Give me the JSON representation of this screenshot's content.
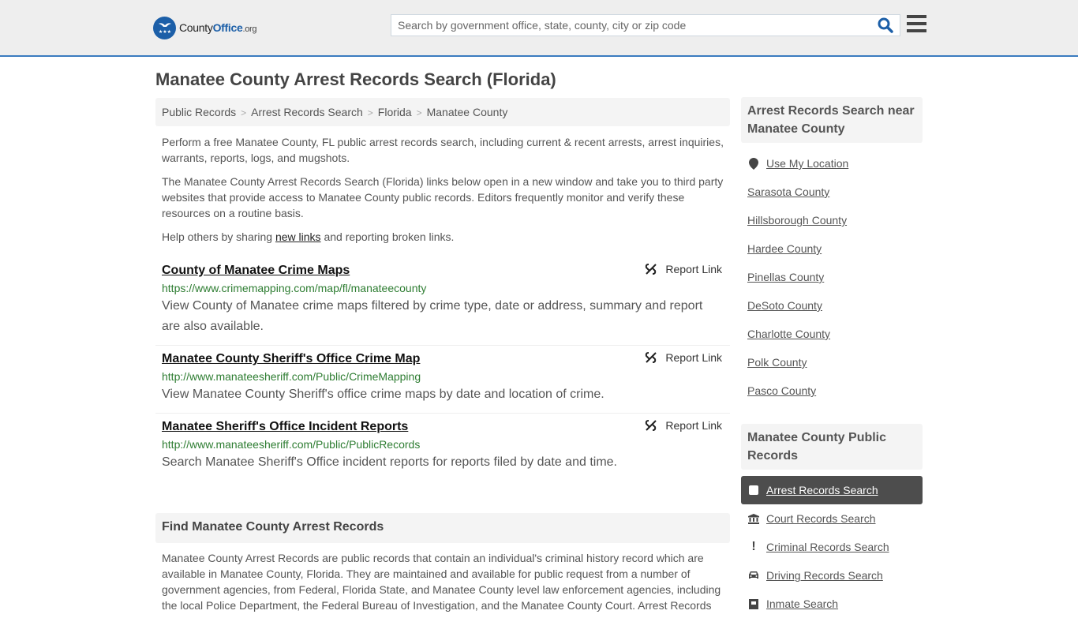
{
  "header": {
    "logo": {
      "brand_plain": "County",
      "brand_bold": "Office",
      "brand_tld": ".org"
    },
    "search": {
      "placeholder": "Search by government office, state, county, city or zip code",
      "value": ""
    },
    "icons": {
      "search": "search-icon",
      "menu": "hamburger-menu-icon"
    }
  },
  "page": {
    "title": "Manatee County Arrest Records Search (Florida)"
  },
  "breadcrumb": [
    "Public Records",
    "Arrest Records Search",
    "Florida",
    "Manatee County"
  ],
  "intro": {
    "p1": "Perform a free Manatee County, FL public arrest records search, including current & recent arrests, arrest inquiries, warrants, reports, logs, and mugshots.",
    "p2": "The Manatee County Arrest Records Search (Florida) links below open in a new window and take you to third party websites that provide access to Manatee County public records. Editors frequently monitor and verify these resources on a routine basis.",
    "p3_before": "Help others by sharing ",
    "p3_link": "new links",
    "p3_after": " and reporting broken links."
  },
  "links": [
    {
      "title": "County of Manatee Crime Maps",
      "url": "https://www.crimemapping.com/map/fl/manateecounty",
      "description": "View County of Manatee crime maps filtered by crime type, date or address, summary and report are also available.",
      "report_label": "Report Link"
    },
    {
      "title": "Manatee County Sheriff's Office Crime Map",
      "url": "http://www.manateesheriff.com/Public/CrimeMapping",
      "description": "View Manatee County Sheriff's office crime maps by date and location of crime.",
      "report_label": "Report Link"
    },
    {
      "title": "Manatee Sheriff's Office Incident Reports",
      "url": "http://www.manateesheriff.com/Public/PublicRecords",
      "description": "Search Manatee Sheriff's Office incident reports for reports filed by date and time.",
      "report_label": "Report Link"
    }
  ],
  "find": {
    "heading": "Find Manatee County Arrest Records",
    "body": "Manatee County Arrest Records are public records that contain an individual's criminal history record which are available in Manatee County, Florida. They are maintained and available for public request from a number of government agencies, from Federal, Florida State, and Manatee County level law enforcement agencies, including the local Police Department, the Federal Bureau of Investigation, and the Manatee County Court. Arrest Records"
  },
  "sidebar": {
    "nearby": {
      "heading": "Arrest Records Search near Manatee County",
      "use_location": "Use My Location",
      "counties": [
        "Sarasota County",
        "Hillsborough County",
        "Hardee County",
        "Pinellas County",
        "DeSoto County",
        "Charlotte County",
        "Polk County",
        "Pasco County"
      ]
    },
    "public_records": {
      "heading": "Manatee County Public Records",
      "items": [
        {
          "label": "Arrest Records Search",
          "icon": "square-icon",
          "active": true
        },
        {
          "label": "Court Records Search",
          "icon": "courthouse-icon",
          "active": false
        },
        {
          "label": "Criminal Records Search",
          "icon": "exclamation-icon",
          "active": false
        },
        {
          "label": "Driving Records Search",
          "icon": "car-icon",
          "active": false
        },
        {
          "label": "Inmate Search",
          "icon": "inmate-icon",
          "active": false
        }
      ]
    }
  },
  "colors": {
    "brand_blue": "#1c5fa8",
    "header_border": "#3a7bbf",
    "url_green": "#2e7d32",
    "active_bg": "#4d4d4d"
  }
}
